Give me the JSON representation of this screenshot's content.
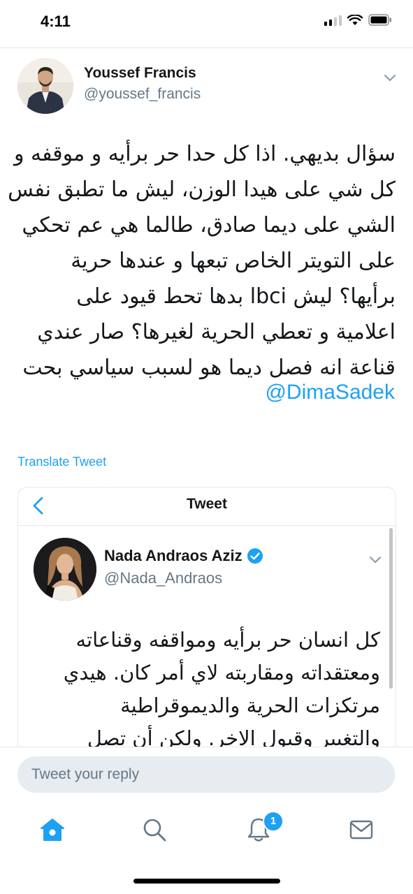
{
  "status_bar": {
    "time": "4:11",
    "icons": [
      "signal-icon",
      "wifi-icon",
      "battery-icon"
    ]
  },
  "tweet": {
    "author_name": "Youssef Francis",
    "author_handle": "@youssef_francis",
    "body_lines": [
      "سؤال بديهي. اذا كل حدا حر برأيه و موقفه و",
      "كل شي على هيدا الوزن، ليش ما تطبق نفس",
      "الشي على ديما صادق، طالما هي عم تحكي",
      "على التويتر الخاص تبعها و عندها حرية",
      "برأيها؟ ليش lbci بدها تحط قيود على",
      "اعلامية و تعطي الحرية لغيرها؟ صار عندي",
      "قناعة انه فصل ديما هو لسبب سياسي بحت"
    ],
    "mention": "@DimaSadek",
    "translate_label": "Translate Tweet"
  },
  "quoted": {
    "header_title": "Tweet",
    "author_name": "Nada Andraos Aziz",
    "author_handle": "@Nada_Andraos",
    "verified": true,
    "body_lines": [
      "كل انسان حر برأيه ومواقفه وقناعاته",
      "ومعتقداته ومقاربته لاي أمر كان. هيدي",
      "مرتكزات الحرية والديموقراطية",
      "والتغيير وقبول الاخر. ولكن أن تصل"
    ]
  },
  "reply": {
    "placeholder": "Tweet your reply"
  },
  "tab_bar": {
    "tabs": [
      "home-icon",
      "search-icon",
      "notifications-icon",
      "messages-icon"
    ],
    "notification_badge": "1"
  },
  "colors": {
    "accent": "#1da1f2",
    "secondary_text": "#657786",
    "divider": "#e1e8ed",
    "reply_background": "#e6ecf0"
  }
}
